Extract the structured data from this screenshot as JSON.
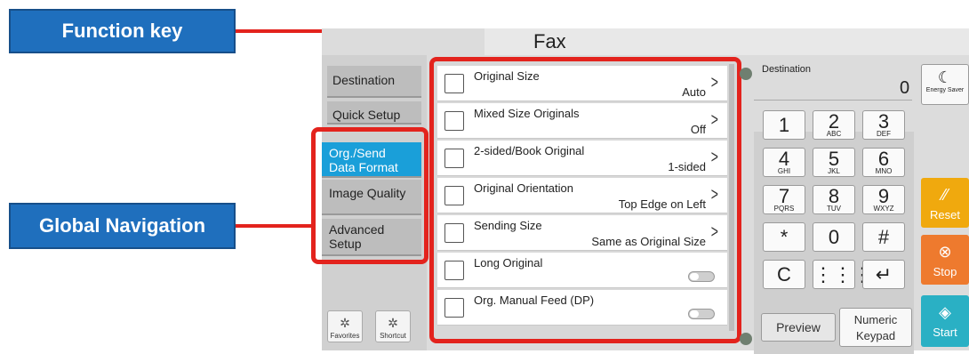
{
  "callouts": {
    "function_key": "Function key",
    "global_navigation": "Global Navigation"
  },
  "header": {
    "title": "Fax"
  },
  "global_nav": {
    "items": [
      {
        "label": "Destination",
        "active": false
      },
      {
        "label": "Quick Setup",
        "active": false
      },
      {
        "label": "Org./Send Data Format",
        "active": true
      },
      {
        "label": "Image Quality",
        "active": false
      },
      {
        "label": "Advanced Setup",
        "active": false
      }
    ]
  },
  "bottom_shortcuts": {
    "favorites": "Favorites",
    "shortcut": "Shortcut"
  },
  "functions": [
    {
      "label": "Original Size",
      "value": "Auto",
      "kind": "chevron",
      "icon": "original-size-icon"
    },
    {
      "label": "Mixed Size Originals",
      "value": "Off",
      "kind": "chevron",
      "icon": "mixed-size-icon"
    },
    {
      "label": "2-sided/Book Original",
      "value": "1-sided",
      "kind": "chevron",
      "icon": "two-sided-icon"
    },
    {
      "label": "Original Orientation",
      "value": "Top Edge on Left",
      "kind": "chevron",
      "icon": "orientation-icon"
    },
    {
      "label": "Sending Size",
      "value": "Same as Original Size",
      "kind": "chevron",
      "icon": "sending-size-icon"
    },
    {
      "label": "Long Original",
      "value": "",
      "kind": "toggle",
      "icon": "long-original-icon"
    },
    {
      "label": "Org. Manual Feed (DP)",
      "value": "",
      "kind": "toggle",
      "icon": "manual-feed-icon"
    }
  ],
  "destination": {
    "label": "Destination",
    "count": "0"
  },
  "keypad": {
    "keys": [
      {
        "d": "1",
        "s": ""
      },
      {
        "d": "2",
        "s": "ABC"
      },
      {
        "d": "3",
        "s": "DEF"
      },
      {
        "d": "4",
        "s": "GHI"
      },
      {
        "d": "5",
        "s": "JKL"
      },
      {
        "d": "6",
        "s": "MNO"
      },
      {
        "d": "7",
        "s": "PQRS"
      },
      {
        "d": "8",
        "s": "TUV"
      },
      {
        "d": "9",
        "s": "WXYZ"
      },
      {
        "d": "*",
        "s": ""
      },
      {
        "d": "0",
        "s": ""
      },
      {
        "d": "#",
        "s": ""
      },
      {
        "d": "C",
        "s": ""
      },
      {
        "d": "⋮⋮⋮",
        "s": ""
      },
      {
        "d": "↵",
        "s": ""
      }
    ]
  },
  "bottom_right": {
    "preview": "Preview",
    "numeric_keypad": "Numeric Keypad"
  },
  "side_buttons": {
    "energy_saver": "Energy Saver",
    "reset": "Reset",
    "stop": "Stop",
    "start": "Start"
  },
  "colors": {
    "accent": "#1a9fd9",
    "callout": "#1f6fbd",
    "highlight": "#e3231d",
    "reset": "#f0a90e",
    "stop": "#ee7a2e",
    "start": "#2ab0c4"
  }
}
